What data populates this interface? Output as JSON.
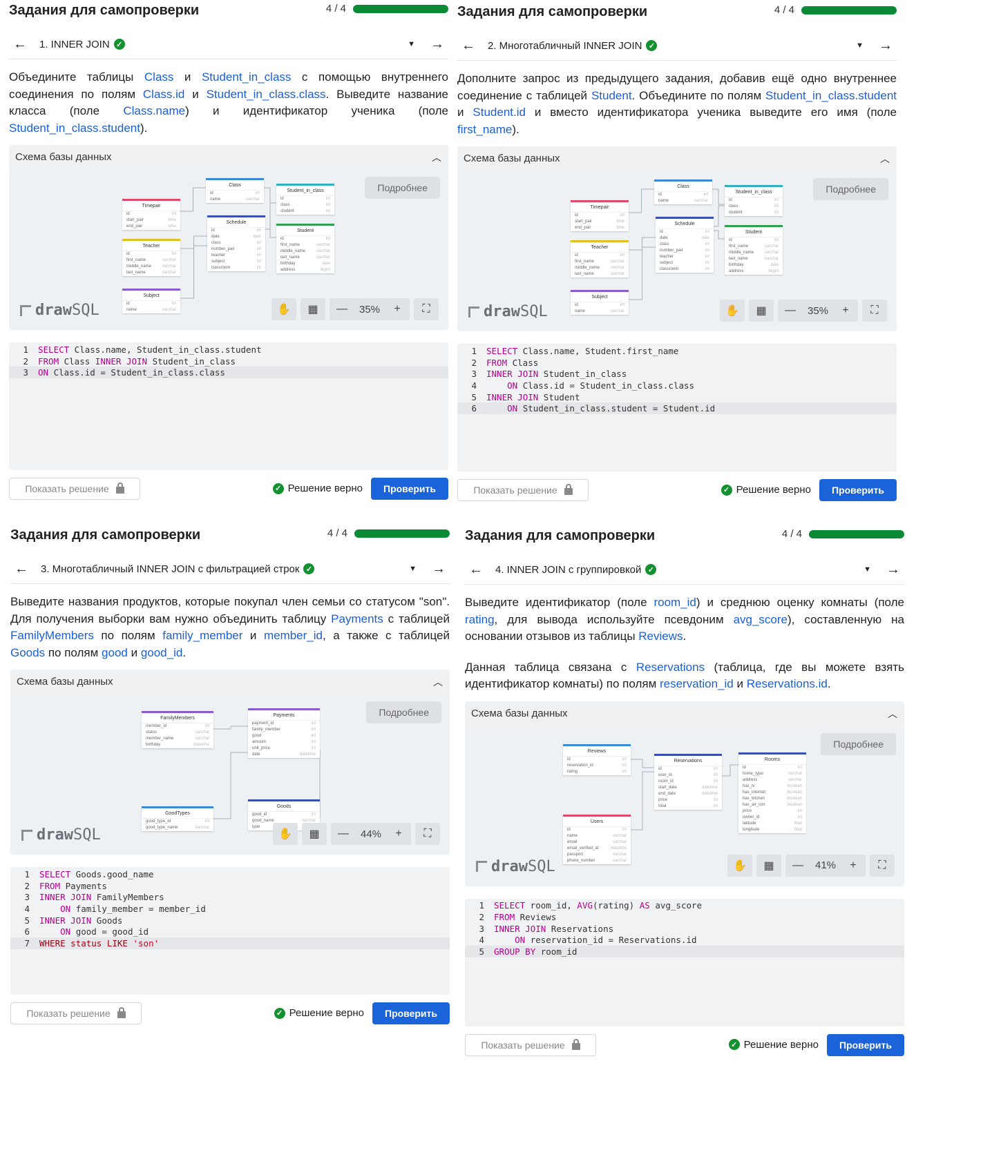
{
  "common": {
    "title": "Задания для самопроверки",
    "progress": "4 / 4",
    "progress_value": 1.0,
    "schema_label": "Схема базы данных",
    "more_label": "Подробнее",
    "logo_draw": "draw",
    "logo_sql": "SQL",
    "show_solution": "Показать решение",
    "status_ok": "Решение верно",
    "check_label": "Проверить",
    "accent": "#1a63d8",
    "success": "#14912f"
  },
  "panels": [
    {
      "task": "1. INNER JOIN",
      "zoom": "35%",
      "desc": [
        [
          "Объедините таблицы ",
          "Class",
          " и ",
          "Student_in_class",
          " с помощью внутреннего соединения по полям ",
          "Class.id",
          " и ",
          "Student_in_class.class",
          ". Выведите название класса (поле ",
          "Class.name",
          ") и идентификатор ученика (поле ",
          "Student_in_class.student",
          ")."
        ]
      ],
      "code": [
        "SELECT Class.name, Student_in_class.student",
        "FROM Class INNER JOIN Student_in_class",
        "ON Class.id = Student_in_class.class"
      ]
    },
    {
      "task": "2. Многотабличный INNER JOIN",
      "zoom": "35%",
      "desc": [
        [
          "Дополните запрос из предыдущего задания, добавив ещё одно внутреннее соединение с таблицей ",
          "Student",
          ". Объедините по полям ",
          "Student_in_class.student",
          " и ",
          "Student.id",
          " и вместо идентификатора ученика выведите его имя (поле ",
          "first_name",
          ")."
        ]
      ],
      "code": [
        "SELECT Class.name, Student.first_name",
        "FROM Class",
        "INNER JOIN Student_in_class",
        "    ON Class.id = Student_in_class.class",
        "INNER JOIN Student",
        "    ON Student_in_class.student = Student.id"
      ]
    },
    {
      "task": "3. Многотабличный INNER JOIN с фильтрацией строк",
      "zoom": "44%",
      "desc": [
        [
          "Выведите названия продуктов, которые покупал член семьи со статусом \"son\". Для получения выборки вам нужно объединить таблицу ",
          "Payments",
          " с таблицей ",
          "FamilyMembers",
          " по полям ",
          "family_member",
          " и ",
          "member_id",
          ", а также с таблицей ",
          "Goods",
          " по полям ",
          "good",
          " и ",
          "good_id",
          "."
        ]
      ],
      "code": [
        "SELECT Goods.good_name",
        "FROM Payments",
        "INNER JOIN FamilyMembers",
        "    ON family_member = member_id",
        "INNER JOIN Goods",
        "    ON good = good_id",
        "WHERE status LIKE 'son'"
      ]
    },
    {
      "task": "4. INNER JOIN с группировкой",
      "zoom": "41%",
      "desc": [
        [
          "Выведите идентификатор (поле ",
          "room_id",
          ") и среднюю оценку комнаты (поле ",
          "rating",
          ", для вывода используйте псевдоним ",
          "avg_score",
          "), составленную на основании отзывов из таблицы ",
          "Reviews",
          "."
        ],
        [
          "Данная таблица связана с ",
          "Reservations",
          " (таблица, где вы можете взять идентификатор комнаты) по полям ",
          "reservation_id",
          " и ",
          "Reservations.id",
          "."
        ]
      ],
      "code": [
        "SELECT room_id, AVG(rating) AS avg_score",
        "FROM Reviews",
        "INNER JOIN Reservations",
        "    ON reservation_id = Reservations.id",
        "GROUP BY room_id"
      ]
    }
  ],
  "schemas": [
    [
      {
        "name": "Timepair",
        "color": "#e04a6a",
        "rows": [
          [
            "id",
            "int"
          ],
          [
            "start_pair",
            "time"
          ],
          [
            "end_pair",
            "time"
          ]
        ]
      },
      {
        "name": "Teacher",
        "color": "#e0c020",
        "rows": [
          [
            "id",
            "int"
          ],
          [
            "first_name",
            "varchar"
          ],
          [
            "middle_name",
            "varchar"
          ],
          [
            "last_name",
            "varchar"
          ]
        ]
      },
      {
        "name": "Subject",
        "color": "#8a5cd0",
        "rows": [
          [
            "id",
            "int"
          ],
          [
            "name",
            "varchar"
          ]
        ]
      },
      {
        "name": "Class",
        "color": "#3a8ad8",
        "rows": [
          [
            "id",
            "int"
          ],
          [
            "name",
            "varchar"
          ]
        ]
      },
      {
        "name": "Schedule",
        "color": "#3a50b0",
        "rows": [
          [
            "id",
            "int"
          ],
          [
            "date",
            "date"
          ],
          [
            "class",
            "int"
          ],
          [
            "number_pair",
            "int"
          ],
          [
            "teacher",
            "int"
          ],
          [
            "subject",
            "int"
          ],
          [
            "classroom",
            "int"
          ]
        ]
      },
      {
        "name": "Student_in_class",
        "color": "#30b0c0",
        "rows": [
          [
            "id",
            "int"
          ],
          [
            "class",
            "int"
          ],
          [
            "student",
            "int"
          ]
        ]
      },
      {
        "name": "Student",
        "color": "#30a050",
        "rows": [
          [
            "id",
            "int"
          ],
          [
            "first_name",
            "varchar"
          ],
          [
            "middle_name",
            "varchar"
          ],
          [
            "last_name",
            "varchar"
          ],
          [
            "birthday",
            "date"
          ],
          [
            "address",
            "bigint"
          ]
        ]
      }
    ],
    [
      {
        "name": "Timepair",
        "color": "#e04a6a",
        "rows": [
          [
            "id",
            "int"
          ],
          [
            "start_pair",
            "time"
          ],
          [
            "end_pair",
            "time"
          ]
        ]
      },
      {
        "name": "Teacher",
        "color": "#e0c020",
        "rows": [
          [
            "id",
            "int"
          ],
          [
            "first_name",
            "varchar"
          ],
          [
            "middle_name",
            "varchar"
          ],
          [
            "last_name",
            "varchar"
          ]
        ]
      },
      {
        "name": "Subject",
        "color": "#8a5cd0",
        "rows": [
          [
            "id",
            "int"
          ],
          [
            "name",
            "varchar"
          ]
        ]
      },
      {
        "name": "Class",
        "color": "#3a8ad8",
        "rows": [
          [
            "id",
            "int"
          ],
          [
            "name",
            "varchar"
          ]
        ]
      },
      {
        "name": "Schedule",
        "color": "#3a50b0",
        "rows": [
          [
            "id",
            "int"
          ],
          [
            "date",
            "date"
          ],
          [
            "class",
            "int"
          ],
          [
            "number_pair",
            "int"
          ],
          [
            "teacher",
            "int"
          ],
          [
            "subject",
            "int"
          ],
          [
            "classroom",
            "int"
          ]
        ]
      },
      {
        "name": "Student_in_class",
        "color": "#30b0c0",
        "rows": [
          [
            "id",
            "int"
          ],
          [
            "class",
            "int"
          ],
          [
            "student",
            "int"
          ]
        ]
      },
      {
        "name": "Student",
        "color": "#30a050",
        "rows": [
          [
            "id",
            "int"
          ],
          [
            "first_name",
            "varchar"
          ],
          [
            "middle_name",
            "varchar"
          ],
          [
            "last_name",
            "varchar"
          ],
          [
            "birthday",
            "date"
          ],
          [
            "address",
            "bigint"
          ]
        ]
      }
    ],
    [
      {
        "name": "FamilyMembers",
        "color": "#8a5cd0",
        "rows": [
          [
            "member_id",
            "int"
          ],
          [
            "status",
            "varchar"
          ],
          [
            "member_name",
            "varchar"
          ],
          [
            "birthday",
            "datetime"
          ]
        ]
      },
      {
        "name": "Payments",
        "color": "#8a5cd0",
        "rows": [
          [
            "payment_id",
            "int"
          ],
          [
            "family_member",
            "int"
          ],
          [
            "good",
            "int"
          ],
          [
            "amount",
            "int"
          ],
          [
            "unit_price",
            "int"
          ],
          [
            "date",
            "datetime"
          ]
        ]
      },
      {
        "name": "GoodTypes",
        "color": "#3a8ad8",
        "rows": [
          [
            "good_type_id",
            "int"
          ],
          [
            "good_type_name",
            "varchar"
          ]
        ]
      },
      {
        "name": "Goods",
        "color": "#3a50b0",
        "rows": [
          [
            "good_id",
            "int"
          ],
          [
            "good_name",
            "varchar"
          ],
          [
            "type",
            "int"
          ]
        ]
      }
    ],
    [
      {
        "name": "Reviews",
        "color": "#3a8ad8",
        "rows": [
          [
            "id",
            "int"
          ],
          [
            "reservation_id",
            "int"
          ],
          [
            "rating",
            "int"
          ]
        ]
      },
      {
        "name": "Reservations",
        "color": "#3a50b0",
        "rows": [
          [
            "id",
            "int"
          ],
          [
            "user_id",
            "int"
          ],
          [
            "room_id",
            "int"
          ],
          [
            "start_date",
            "datetime"
          ],
          [
            "end_date",
            "datetime"
          ],
          [
            "price",
            "int"
          ],
          [
            "total",
            "int"
          ]
        ]
      },
      {
        "name": "Rooms",
        "color": "#3a50b0",
        "rows": [
          [
            "id",
            "int"
          ],
          [
            "home_type",
            "varchar"
          ],
          [
            "address",
            "varchar"
          ],
          [
            "has_tv",
            "boolean"
          ],
          [
            "has_internet",
            "boolean"
          ],
          [
            "has_kitchen",
            "boolean"
          ],
          [
            "has_air_con",
            "boolean"
          ],
          [
            "price",
            "int"
          ],
          [
            "owner_id",
            "int"
          ],
          [
            "latitude",
            "float"
          ],
          [
            "longitude",
            "float"
          ]
        ]
      },
      {
        "name": "Users",
        "color": "#e04a6a",
        "rows": [
          [
            "id",
            "int"
          ],
          [
            "name",
            "varchar"
          ],
          [
            "email",
            "varchar"
          ],
          [
            "email_verified_at",
            "datetime"
          ],
          [
            "passport",
            "varchar"
          ],
          [
            "phone_number",
            "varchar"
          ]
        ]
      }
    ]
  ]
}
